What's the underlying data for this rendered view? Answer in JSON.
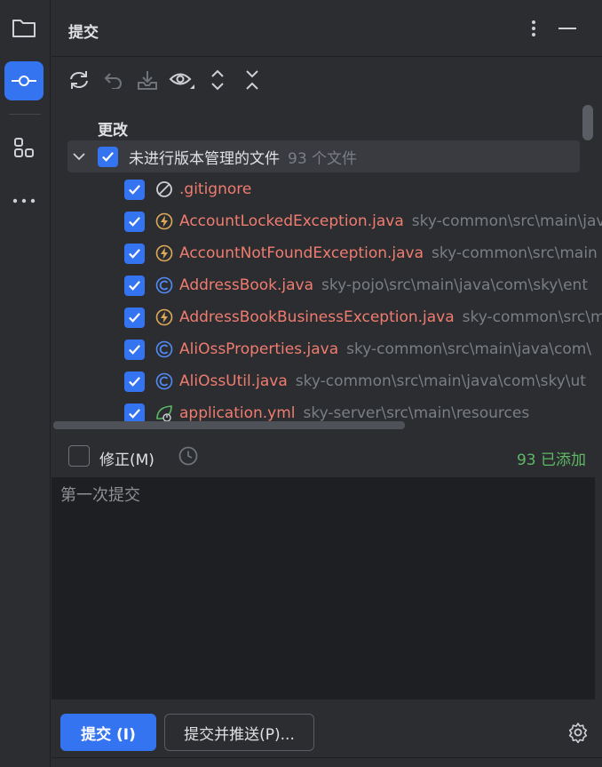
{
  "header": {
    "title": "提交"
  },
  "tree": {
    "section_label": "更改",
    "group": {
      "label": "未进行版本管理的文件",
      "count": "93 个文件"
    },
    "files": [
      {
        "name": ".gitignore",
        "path": "",
        "icon": "ignore-icon"
      },
      {
        "name": "AccountLockedException.java",
        "path": "sky-common\\src\\main\\java",
        "icon": "exception-icon"
      },
      {
        "name": "AccountNotFoundException.java",
        "path": "sky-common\\src\\main",
        "icon": "exception-icon"
      },
      {
        "name": "AddressBook.java",
        "path": "sky-pojo\\src\\main\\java\\com\\sky\\ent",
        "icon": "class-icon"
      },
      {
        "name": "AddressBookBusinessException.java",
        "path": "sky-common\\src\\m",
        "icon": "exception-icon"
      },
      {
        "name": "AliOssProperties.java",
        "path": "sky-common\\src\\main\\java\\com\\",
        "icon": "class-icon"
      },
      {
        "name": "AliOssUtil.java",
        "path": "sky-common\\src\\main\\java\\com\\sky\\ut",
        "icon": "class-icon"
      },
      {
        "name": "application.yml",
        "path": "sky-server\\src\\main\\resources",
        "icon": "spring-config-icon"
      }
    ]
  },
  "amend": {
    "label": "修正(M)",
    "status": "93 已添加"
  },
  "message": {
    "value": "第一次提交"
  },
  "footer": {
    "commit_label": "提交 (I)",
    "commit_push_label": "提交并推送(P)..."
  },
  "colors": {
    "accent": "#3574f0",
    "unversioned": "#f07c70",
    "added": "#5fb865",
    "exception_icon": "#e0a95a",
    "class_icon": "#548af7"
  }
}
